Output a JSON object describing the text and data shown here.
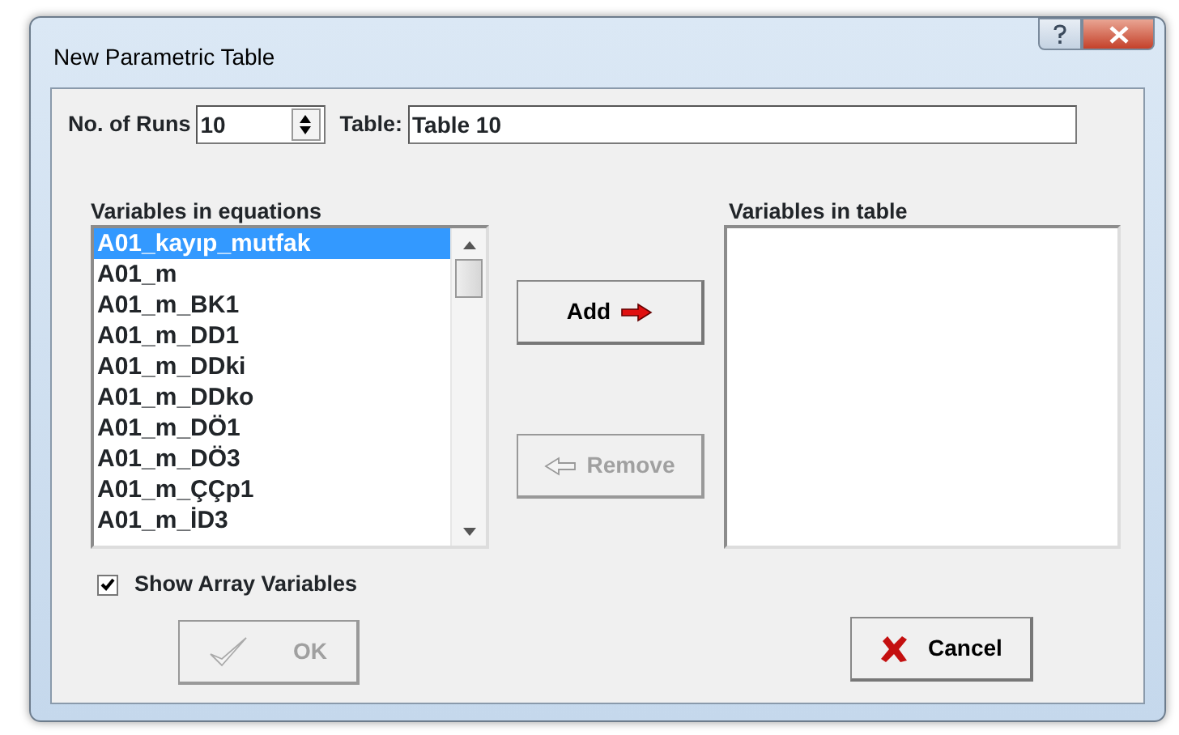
{
  "window": {
    "title": "New Parametric Table"
  },
  "runs": {
    "label": "No. of Runs",
    "value": "10"
  },
  "table": {
    "label": "Table:",
    "value": "Table 10"
  },
  "equations_list": {
    "label": "Variables in equations",
    "items": [
      {
        "text": "A01_kayıp_mutfak",
        "selected": true
      },
      {
        "text": "A01_m",
        "selected": false
      },
      {
        "text": "A01_m_BK1",
        "selected": false
      },
      {
        "text": "A01_m_DD1",
        "selected": false
      },
      {
        "text": "A01_m_DDki",
        "selected": false
      },
      {
        "text": "A01_m_DDko",
        "selected": false
      },
      {
        "text": "A01_m_DÖ1",
        "selected": false
      },
      {
        "text": "A01_m_DÖ3",
        "selected": false
      },
      {
        "text": "A01_m_ÇÇp1",
        "selected": false
      },
      {
        "text": "A01_m_İD3",
        "selected": false
      }
    ]
  },
  "table_list": {
    "label": "Variables in table"
  },
  "add_button": {
    "label": "Add",
    "disabled": false
  },
  "remove_button": {
    "label": "Remove",
    "disabled": true
  },
  "show_array": {
    "label": "Show Array Variables",
    "checked": true
  },
  "ok_button": {
    "label": "OK",
    "disabled": true
  },
  "cancel_button": {
    "label": "Cancel",
    "disabled": false
  }
}
